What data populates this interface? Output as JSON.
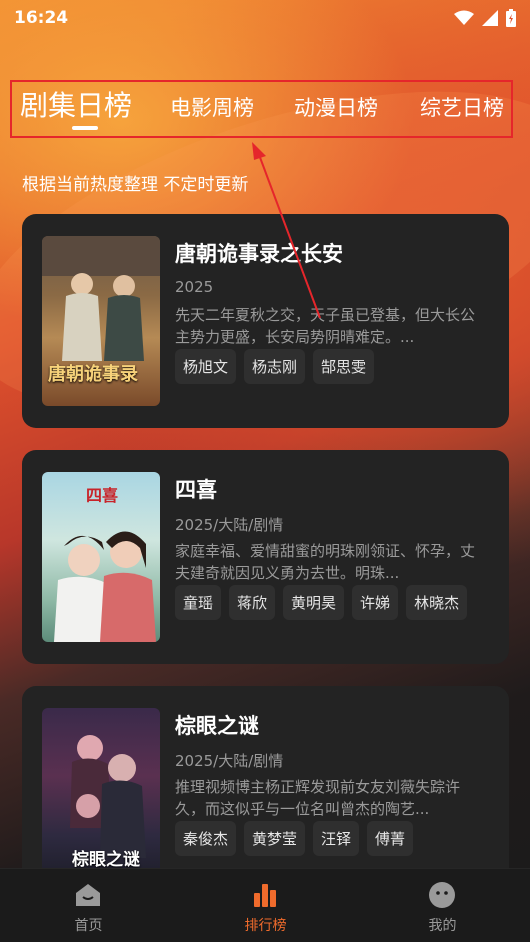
{
  "status_bar": {
    "time": "16:24"
  },
  "tabs": [
    {
      "label": "剧集日榜",
      "active": true
    },
    {
      "label": "电影周榜",
      "active": false
    },
    {
      "label": "动漫日榜",
      "active": false
    },
    {
      "label": "综艺日榜",
      "active": false
    }
  ],
  "subtitle": "根据当前热度整理 不定时更新",
  "cards": [
    {
      "title": "唐朝诡事录之长安",
      "meta": "2025",
      "description": "先天二年夏秋之交，天子虽已登基，但大长公主势力更盛，长安局势阴晴难定。...",
      "poster_text": "唐朝诡事录",
      "tags": [
        "杨旭文",
        "杨志刚",
        "郜思雯"
      ]
    },
    {
      "title": "四喜",
      "meta": "2025/大陆/剧情",
      "description": "家庭幸福、爱情甜蜜的明珠刚领证、怀孕，丈夫建奇就因见义勇为去世。明珠...",
      "poster_text": "四喜",
      "tags": [
        "童瑶",
        "蒋欣",
        "黄明昊",
        "许娣",
        "林晓杰"
      ]
    },
    {
      "title": "棕眼之谜",
      "meta": "2025/大陆/剧情",
      "description": "推理视频博主杨正辉发现前女友刘薇失踪许久，而这似乎与一位名叫曾杰的陶艺...",
      "poster_text": "棕眼之谜",
      "tags": [
        "秦俊杰",
        "黄梦莹",
        "汪铎",
        "傅菁"
      ]
    }
  ],
  "bottom_nav": [
    {
      "label": "首页",
      "icon": "home-icon",
      "active": false
    },
    {
      "label": "排行榜",
      "icon": "ranking-icon",
      "active": true
    },
    {
      "label": "我的",
      "icon": "profile-icon",
      "active": false
    }
  ],
  "colors": {
    "accent": "#f06b2c",
    "highlight_box": "#e5262b"
  }
}
